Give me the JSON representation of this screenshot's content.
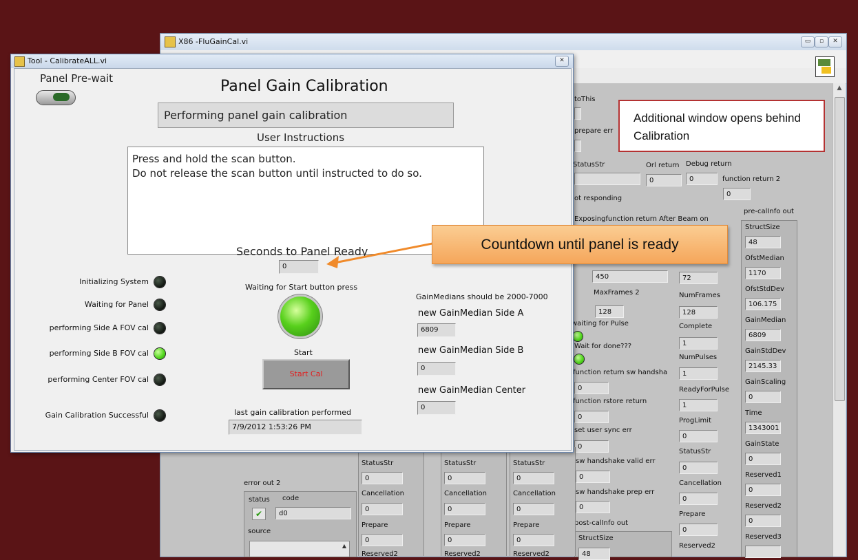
{
  "back_window": {
    "title": "X86 -FluGainCal.vi",
    "labels": {
      "toThis": "toThis",
      "prepare_err": "prepare err",
      "statusstr": "StatusStr",
      "orl_return": "Orl return",
      "debug_return": "Debug return",
      "function_return_2": "function return 2",
      "not_responding": "ot responding",
      "exposing": "Exposingfunction return After Beam on",
      "maxframes2": "MaxFrames 2",
      "numframes": "NumFrames",
      "waiting_pulse": "waiting for Pulse",
      "complete": "Complete",
      "wait_done": "Wait for done???",
      "numpulses": "NumPulses",
      "fn_sw_handshake": "function return sw handsha",
      "readyforpulse": "ReadyForPulse",
      "fn_rstore": "function rstore return",
      "proglimit": "ProgLimit",
      "set_user_sync": "set user sync err",
      "statusstr2": "StatusStr",
      "sw_valid_err": "sw handshake valid err",
      "cancellation": "Cancellation",
      "sw_prep_err": "sw handshake prep err",
      "prepare": "Prepare",
      "post_callinfo": "post-calInfo out",
      "reserved2": "Reserved2",
      "structsize2": "StructSize",
      "error_out_2": "error out 2",
      "status": "status",
      "code": "code",
      "source": "source",
      "prepare2": "Prepare"
    },
    "values": {
      "orl": "0",
      "debug": "0",
      "fn2": "0",
      "v450": "450",
      "v72": "72",
      "maxframes": "128",
      "numframes": "128",
      "complete": "1",
      "numpulses": "1",
      "sw_handsha": "0",
      "ready": "1",
      "rstore": "0",
      "proglimit": "0",
      "user_sync": "0",
      "status_str": "0",
      "valid_err": "0",
      "cancellation": "0",
      "prep_err": "0",
      "prepare": "0",
      "structsize_post": "48",
      "error_code": "d0"
    },
    "pre_callinfo": {
      "title": "pre-calInfo out",
      "items": [
        {
          "label": "StructSize",
          "value": "48"
        },
        {
          "label": "OfstMedian",
          "value": "1170"
        },
        {
          "label": "OfstStdDev",
          "value": "106.175"
        },
        {
          "label": "GainMedian",
          "value": "6809"
        },
        {
          "label": "GainStdDev",
          "value": "2145.33"
        },
        {
          "label": "GainScaling",
          "value": "0"
        },
        {
          "label": "Time",
          "value": "1343001"
        },
        {
          "label": "GainState",
          "value": "0"
        },
        {
          "label": "Reserved1",
          "value": "0"
        },
        {
          "label": "Reserved2",
          "value": "0"
        },
        {
          "label": "Reserved3",
          "value": ""
        }
      ]
    },
    "cluster_columns": [
      {
        "statusstr": "StatusStr",
        "status_val": "0",
        "cancellation": "Cancellation",
        "cancel_val": "0",
        "prepare": "Prepare",
        "prepare_val": "0",
        "reserved": "Reserved2"
      },
      {
        "statusstr": "StatusStr",
        "status_val": "0",
        "cancellation": "Cancellation",
        "cancel_val": "0",
        "prepare": "Prepare",
        "prepare_val": "0",
        "reserved": "Reserved2"
      },
      {
        "statusstr": "StatusStr",
        "status_val": "0",
        "cancellation": "Cancellation",
        "cancel_val": "0",
        "prepare": "Prepare",
        "prepare_val": "0",
        "reserved": "Reserved2"
      }
    ]
  },
  "front_window": {
    "title": "Tool - CalibrateALL.vi",
    "panel_prewait": "Panel Pre-wait",
    "heading": "Panel Gain Calibration",
    "status_text": "Performing  panel gain calibration",
    "instructions_label": "User Instructions",
    "instructions_line1": "Press and hold the scan button.",
    "instructions_line2": "Do not release the scan button until instructed to do so.",
    "seconds_label": "Seconds to Panel Ready",
    "seconds_value": "0",
    "waiting_start": "Waiting for Start button press",
    "start_label": "Start",
    "start_button": "Start Cal",
    "last_gain_label": "last gain calibration performed",
    "last_gain_value": "7/9/2012 1:53:26 PM",
    "gain_note": "GainMedians should be 2000-7000",
    "side_a_label": "new GainMedian Side A",
    "side_a_value": "6809",
    "side_b_label": "new GainMedian Side B",
    "side_b_value": "0",
    "center_label": "new GainMedian Center",
    "center_value": "0",
    "leds": [
      {
        "label": "Initializing System",
        "on": false
      },
      {
        "label": "Waiting for Panel",
        "on": false
      },
      {
        "label": "performing Side A FOV cal",
        "on": false
      },
      {
        "label": "performing Side B FOV cal",
        "on": true
      },
      {
        "label": "performing Center FOV cal",
        "on": false
      },
      {
        "label": "Gain Calibration Successful",
        "on": false
      }
    ]
  },
  "callouts": {
    "additional_window": "Additional window opens behind Calibration",
    "countdown": "Countdown until panel is ready"
  },
  "colors": {
    "desktop": "#5a1416",
    "panel": "#c8c8c8",
    "callout_orange": "#f7b26a",
    "led_green": "#4ed41a",
    "start_text": "#e02020"
  }
}
